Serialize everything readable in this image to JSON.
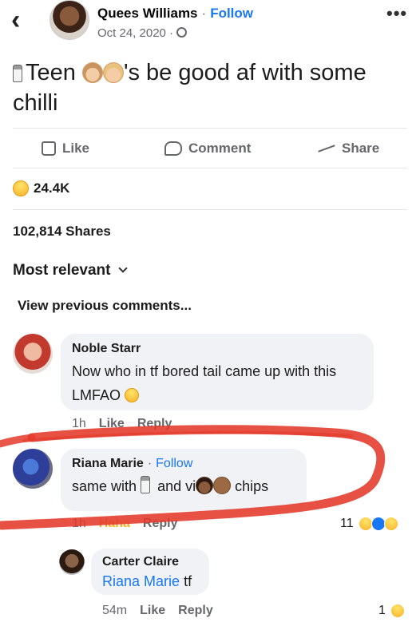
{
  "header": {
    "author": "Quees Williams",
    "separator": "·",
    "follow": "Follow",
    "date": "Oct 24, 2020 ·"
  },
  "post": {
    "text_before": "Teen",
    "text_after": "'s  be good af with some chilli"
  },
  "actions": {
    "like": "Like",
    "comment": "Comment",
    "share": "Share"
  },
  "stats": {
    "reactions": "24.4K",
    "shares": "102,814 Shares"
  },
  "sort": {
    "label": "Most relevant"
  },
  "view_previous": "View previous comments...",
  "comments": [
    {
      "name": "Noble Starr",
      "text": "Now who in tf bored tail came up with this",
      "text2": "LMFAO",
      "time": "1h",
      "like": "Like",
      "reply": "Reply"
    },
    {
      "name": "Riana Marie",
      "separator": "·",
      "follow": "Follow",
      "text_a": "same with",
      "text_b": "and vi",
      "text_c": "chips",
      "time": "1h",
      "reaction": "Haha",
      "reply": "Reply",
      "reaction_count": "11"
    },
    {
      "name": "Carter Claire",
      "mention": "Riana Marie",
      "text": "tf",
      "time": "54m",
      "like": "Like",
      "reply": "Reply",
      "reaction_count": "1"
    }
  ],
  "colors": {
    "accent": "#1877f2",
    "muted": "#65676b",
    "bubble": "#f0f2f5",
    "scribble": "#e4392a"
  },
  "icons": [
    "back-arrow-icon",
    "globe-icon",
    "more-icon",
    "salt-shaker-icon",
    "like-icon",
    "comment-icon",
    "share-icon",
    "haha-icon",
    "chevron-down-icon",
    "wow-icon"
  ]
}
